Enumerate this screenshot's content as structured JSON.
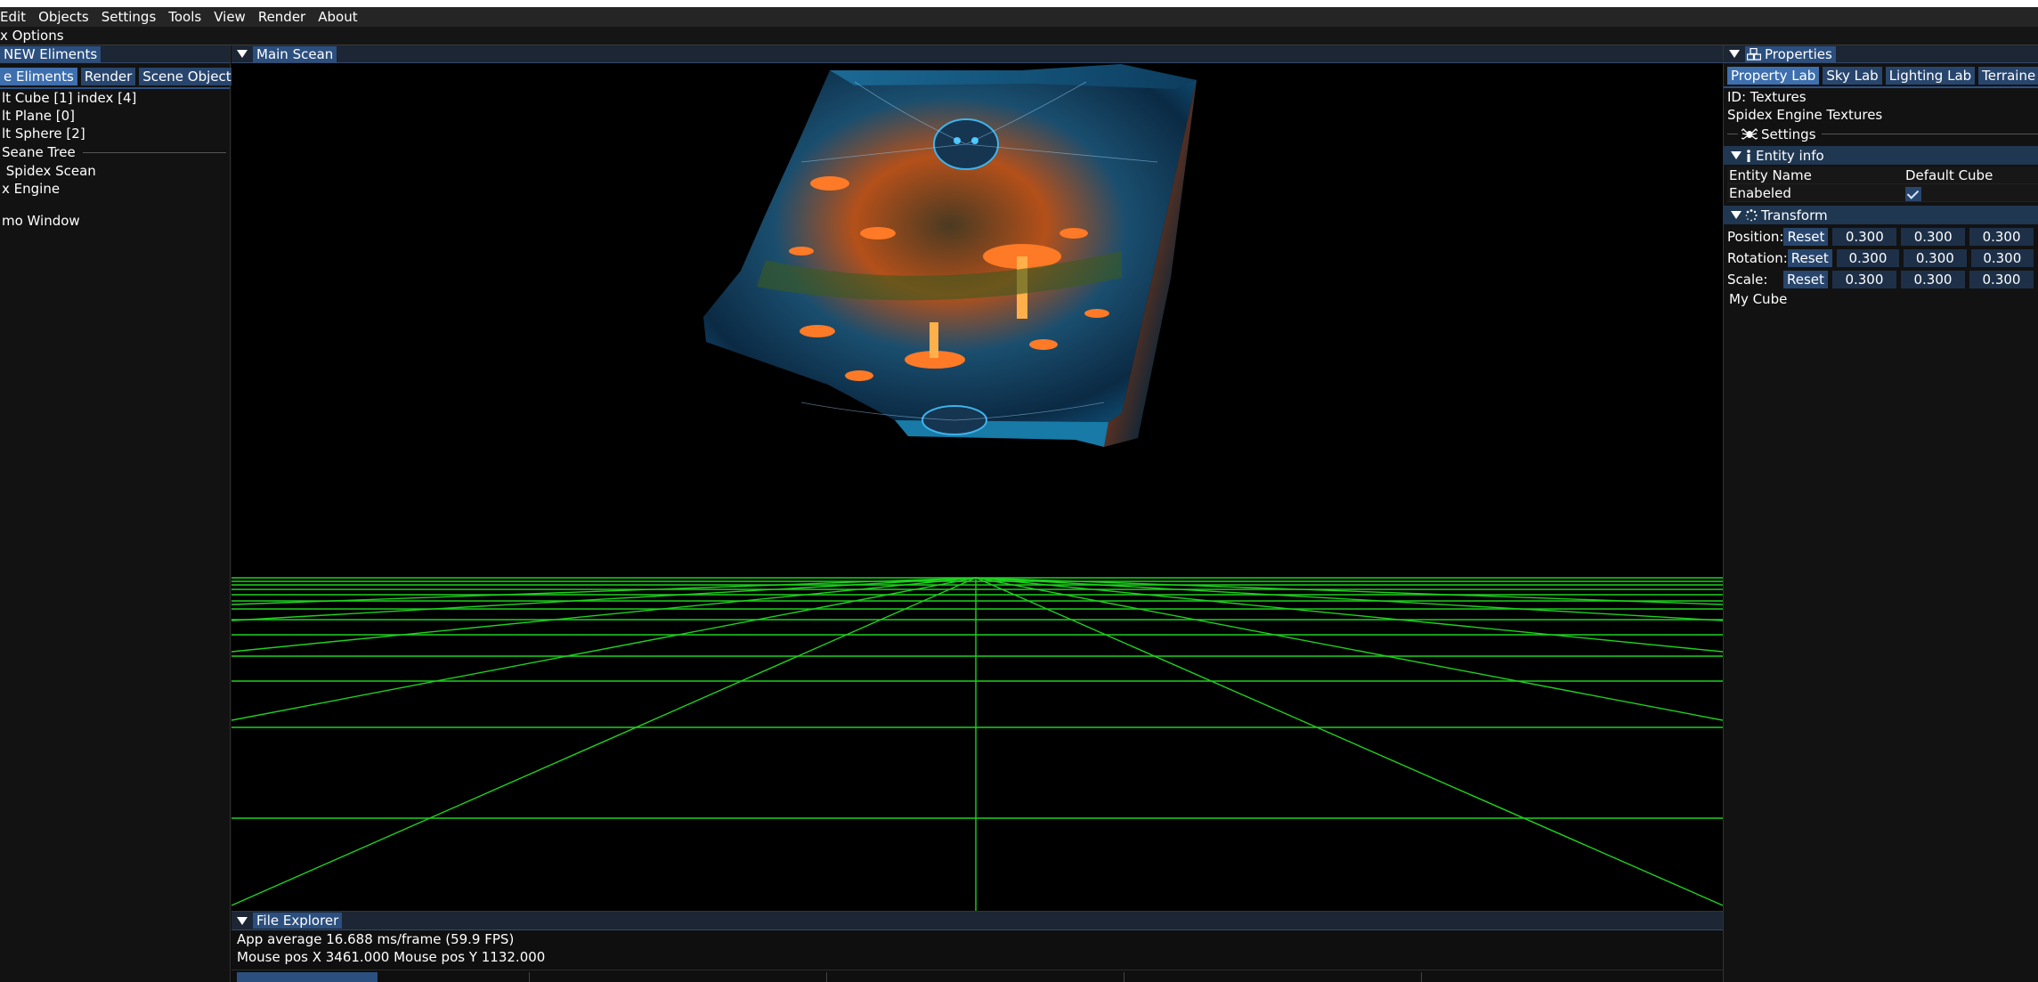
{
  "menu": {
    "items": [
      "Edit",
      "Objects",
      "Settings",
      "Tools",
      "View",
      "Render",
      "About"
    ]
  },
  "options_bar": {
    "label": "x Options"
  },
  "left_panel": {
    "title": "NEW Eliments",
    "tabs": [
      "e Eliments",
      "Render",
      "Scene Objects"
    ],
    "objects": [
      "lt Cube [1] index [4]",
      "lt Plane [0]",
      "lt Sphere [2]"
    ],
    "section_title": "Seane Tree",
    "tree": [
      "Spidex Scean",
      "x Engine"
    ],
    "footer_item": "mo Window"
  },
  "viewport": {
    "title": "Main Scean",
    "grid_color": "#1fd11f"
  },
  "file_explorer": {
    "title": "File Explorer",
    "fps_text": "App average 16.688 ms/frame (59.9 FPS)",
    "mouse_text": "Mouse pos X 3461.000 Mouse pos Y 1132.000"
  },
  "properties": {
    "title": "Properties",
    "title_icon": "cubes-icon",
    "tabs": [
      "Property Lab",
      "Sky Lab",
      "Lighting Lab",
      "Terraine Lab"
    ],
    "id_text": "ID: Textures",
    "textures_text": "Spidex Engine Textures",
    "settings_label": "Settings",
    "settings_icon": "spider-icon",
    "entity_info": {
      "header": "Entity info",
      "name_label": "Entity Name",
      "name_value": "Default Cube",
      "enabled_label": "Enabeled",
      "enabled": true
    },
    "transform": {
      "header": "Transform",
      "rows": [
        {
          "label": "Position:",
          "reset": "Reset",
          "x": "0.300",
          "y": "0.300",
          "z": "0.300"
        },
        {
          "label": "Rotation:",
          "reset": "Reset",
          "x": "0.300",
          "y": "0.300",
          "z": "0.300"
        },
        {
          "label": "Scale:",
          "reset": "Reset",
          "x": "0.300",
          "y": "0.300",
          "z": "0.300"
        }
      ]
    },
    "object_name": "My Cube"
  }
}
